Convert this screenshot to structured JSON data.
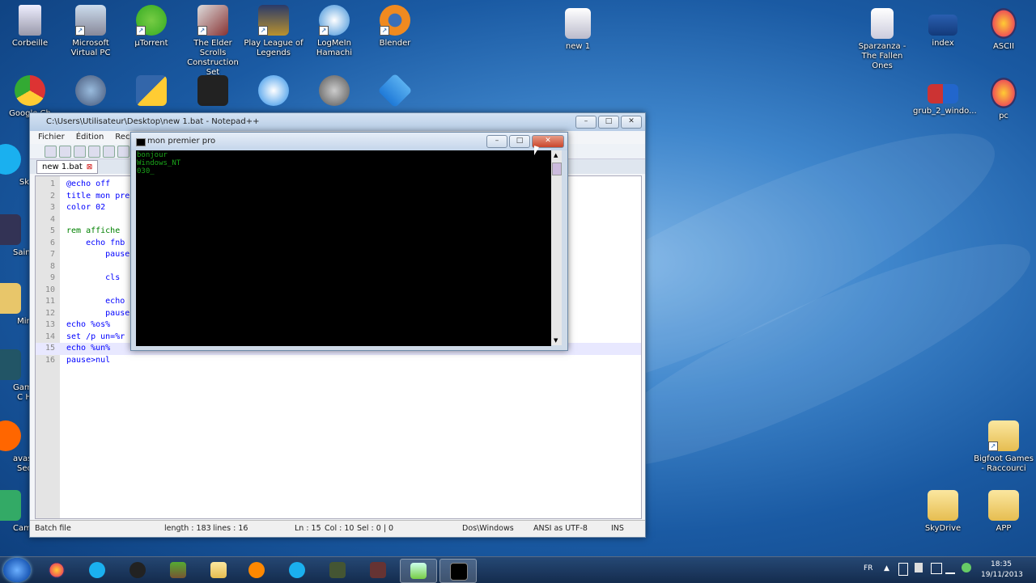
{
  "desktop": {
    "icons_left": [
      {
        "label": "Corbeille",
        "name": "recycle-bin-icon"
      },
      {
        "label": "Microsoft Virtual PC",
        "name": "virtual-pc-icon"
      },
      {
        "label": "µTorrent",
        "name": "utorrent-icon"
      },
      {
        "label": "The Elder Scrolls Construction Set",
        "name": "elder-scrolls-cs-icon"
      },
      {
        "label": "Play League of Legends",
        "name": "league-of-legends-icon"
      },
      {
        "label": "LogMeIn Hamachi",
        "name": "hamachi-icon"
      },
      {
        "label": "Blender",
        "name": "blender-icon"
      },
      {
        "label": "new 1",
        "name": "new-1-file-icon"
      }
    ],
    "icons_row2": [
      {
        "label": "Google Ch",
        "name": "google-chrome-icon"
      }
    ],
    "side_partial_labels": [
      "Sk",
      "Saints",
      "Min",
      "Game C H",
      "avast! Sec",
      "Camtas"
    ],
    "icons_right": [
      {
        "label": "Sparzanza - The Fallen Ones",
        "name": "mp3-file-icon"
      },
      {
        "label": "index",
        "name": "index-file-icon"
      },
      {
        "label": "ASCII",
        "name": "ascii-firefox-icon"
      },
      {
        "label": "grub_2_windo...",
        "name": "grub-file-icon"
      },
      {
        "label": "pc",
        "name": "pc-firefox-icon"
      },
      {
        "label": "Bigfoot Games - Raccourci",
        "name": "bigfoot-games-folder-icon"
      },
      {
        "label": "SkyDrive",
        "name": "skydrive-folder-icon"
      },
      {
        "label": "APP",
        "name": "app-folder-icon"
      }
    ]
  },
  "notepad": {
    "title": "C:\\Users\\Utilisateur\\Desktop\\new 1.bat - Notepad++",
    "menu": [
      "Fichier",
      "Édition",
      "Recherc"
    ],
    "tab": "new 1.bat",
    "lines": [
      "@echo off",
      "title mon pre",
      "color 02",
      "",
      "rem affiche ",
      "    echo fnb",
      "        pause",
      "",
      "        cls",
      "",
      "        echo",
      "        pause",
      "echo %os%",
      "set /p un=%r",
      "echo %un%",
      "pause>nul"
    ],
    "status": {
      "type": "Batch file",
      "length": "length : 183",
      "lines": "lines : 16",
      "ln": "Ln : 15",
      "col": "Col : 10",
      "sel": "Sel : 0 | 0",
      "eol": "Dos\\Windows",
      "encoding": "ANSI as UTF-8",
      "mode": "INS"
    }
  },
  "cmd": {
    "title": "mon premier pro",
    "output": [
      "bonjour",
      "Windows_NT",
      "030_"
    ]
  },
  "taskbar": {
    "apps": [
      "firefox",
      "skype",
      "steam",
      "minecraft",
      "explorer",
      "media-player",
      "skype-2",
      "game-1",
      "game-2",
      "notepad-plus-plus",
      "cmd"
    ],
    "lang": "FR",
    "time": "18:35",
    "date": "19/11/2013"
  },
  "colors": {
    "console_text": "#1aa51a",
    "accent": "#1d5bb8"
  }
}
